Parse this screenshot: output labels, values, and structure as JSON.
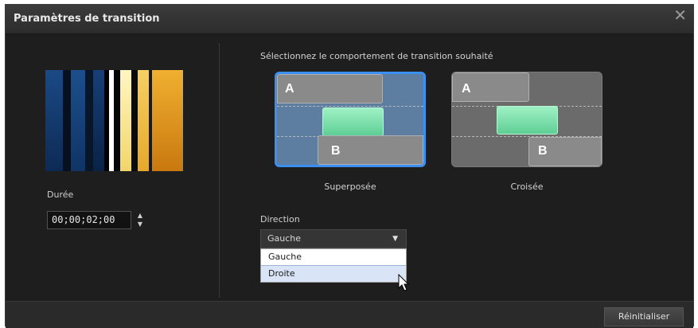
{
  "window": {
    "title": "Paramètres de transition",
    "close_glyph": "✕"
  },
  "left": {
    "duration_label": "Durée",
    "duration_value": "00;00;02;00",
    "spinner_up": "▲",
    "spinner_down": "▼"
  },
  "right": {
    "instruction": "Sélectionnez le comportement de transition souhaité",
    "options": [
      {
        "label": "Superposée",
        "selected": true,
        "letter_a": "A",
        "letter_b": "B"
      },
      {
        "label": "Croisée",
        "selected": false,
        "letter_a": "A",
        "letter_b": "B"
      }
    ],
    "direction_label": "Direction",
    "direction_value": "Gauche",
    "direction_arrow": "▼",
    "direction_options": [
      "Gauche",
      "Droite"
    ]
  },
  "footer": {
    "reset_label": "Réinitialiser"
  },
  "colors": {
    "selection_border": "#3b8ff0",
    "selected_card": "#5d7da1",
    "other_card": "#6a6b6a",
    "overlay_green": "#7fe3ad",
    "dropdown_hover": "#d9e4f7"
  },
  "icons": {
    "close": "close-icon",
    "spinner": "spin-arrows-icon",
    "dropdown": "chevron-down-icon",
    "cursor": "mouse-pointer-icon"
  }
}
